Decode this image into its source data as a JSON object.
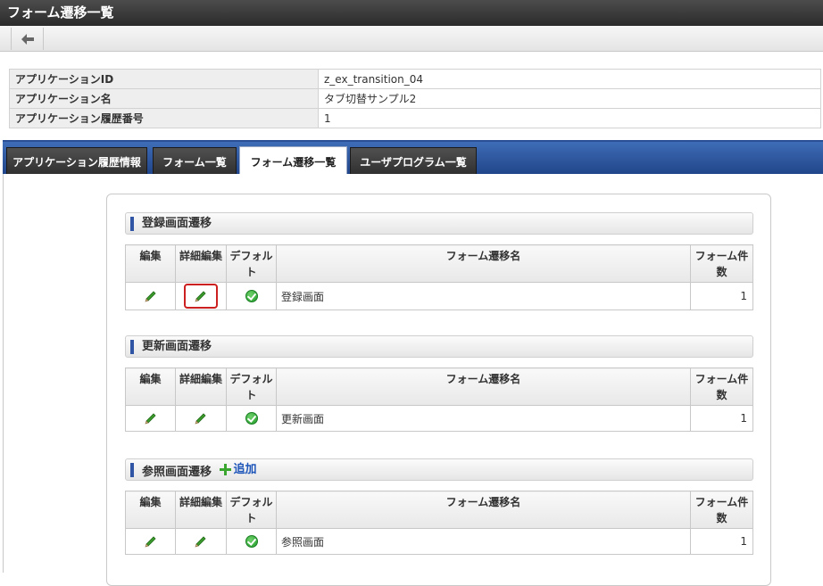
{
  "window": {
    "title": "フォーム遷移一覧"
  },
  "toolbar": {
    "back_icon": "arrow-left-icon"
  },
  "info": [
    {
      "label": "アプリケーションID",
      "value": "z_ex_transition_04"
    },
    {
      "label": "アプリケーション名",
      "value": "タブ切替サンプル2"
    },
    {
      "label": "アプリケーション履歴番号",
      "value": "1"
    }
  ],
  "tabs": [
    {
      "label": "アプリケーション履歴情報"
    },
    {
      "label": "フォーム一覧"
    },
    {
      "label": "フォーム遷移一覧",
      "active": true
    },
    {
      "label": "ユーザプログラム一覧"
    }
  ],
  "columns": {
    "edit": "編集",
    "detail_edit": "詳細編集",
    "default": "デフォルト",
    "name": "フォーム遷移名",
    "count": "フォーム件数"
  },
  "sections": [
    {
      "title": "登録画面遷移",
      "rows": [
        {
          "name": "登録画面",
          "count": "1",
          "default": true
        }
      ]
    },
    {
      "title": "更新画面遷移",
      "rows": [
        {
          "name": "更新画面",
          "count": "1",
          "default": true
        }
      ]
    },
    {
      "title": "参照画面遷移",
      "add_label": "追加",
      "rows": [
        {
          "name": "参照画面",
          "count": "1",
          "default": true
        }
      ]
    }
  ],
  "colors": {
    "accent": "#2f55a4",
    "highlight": "#cc1f1f",
    "tabbar": "#2b4f94"
  }
}
